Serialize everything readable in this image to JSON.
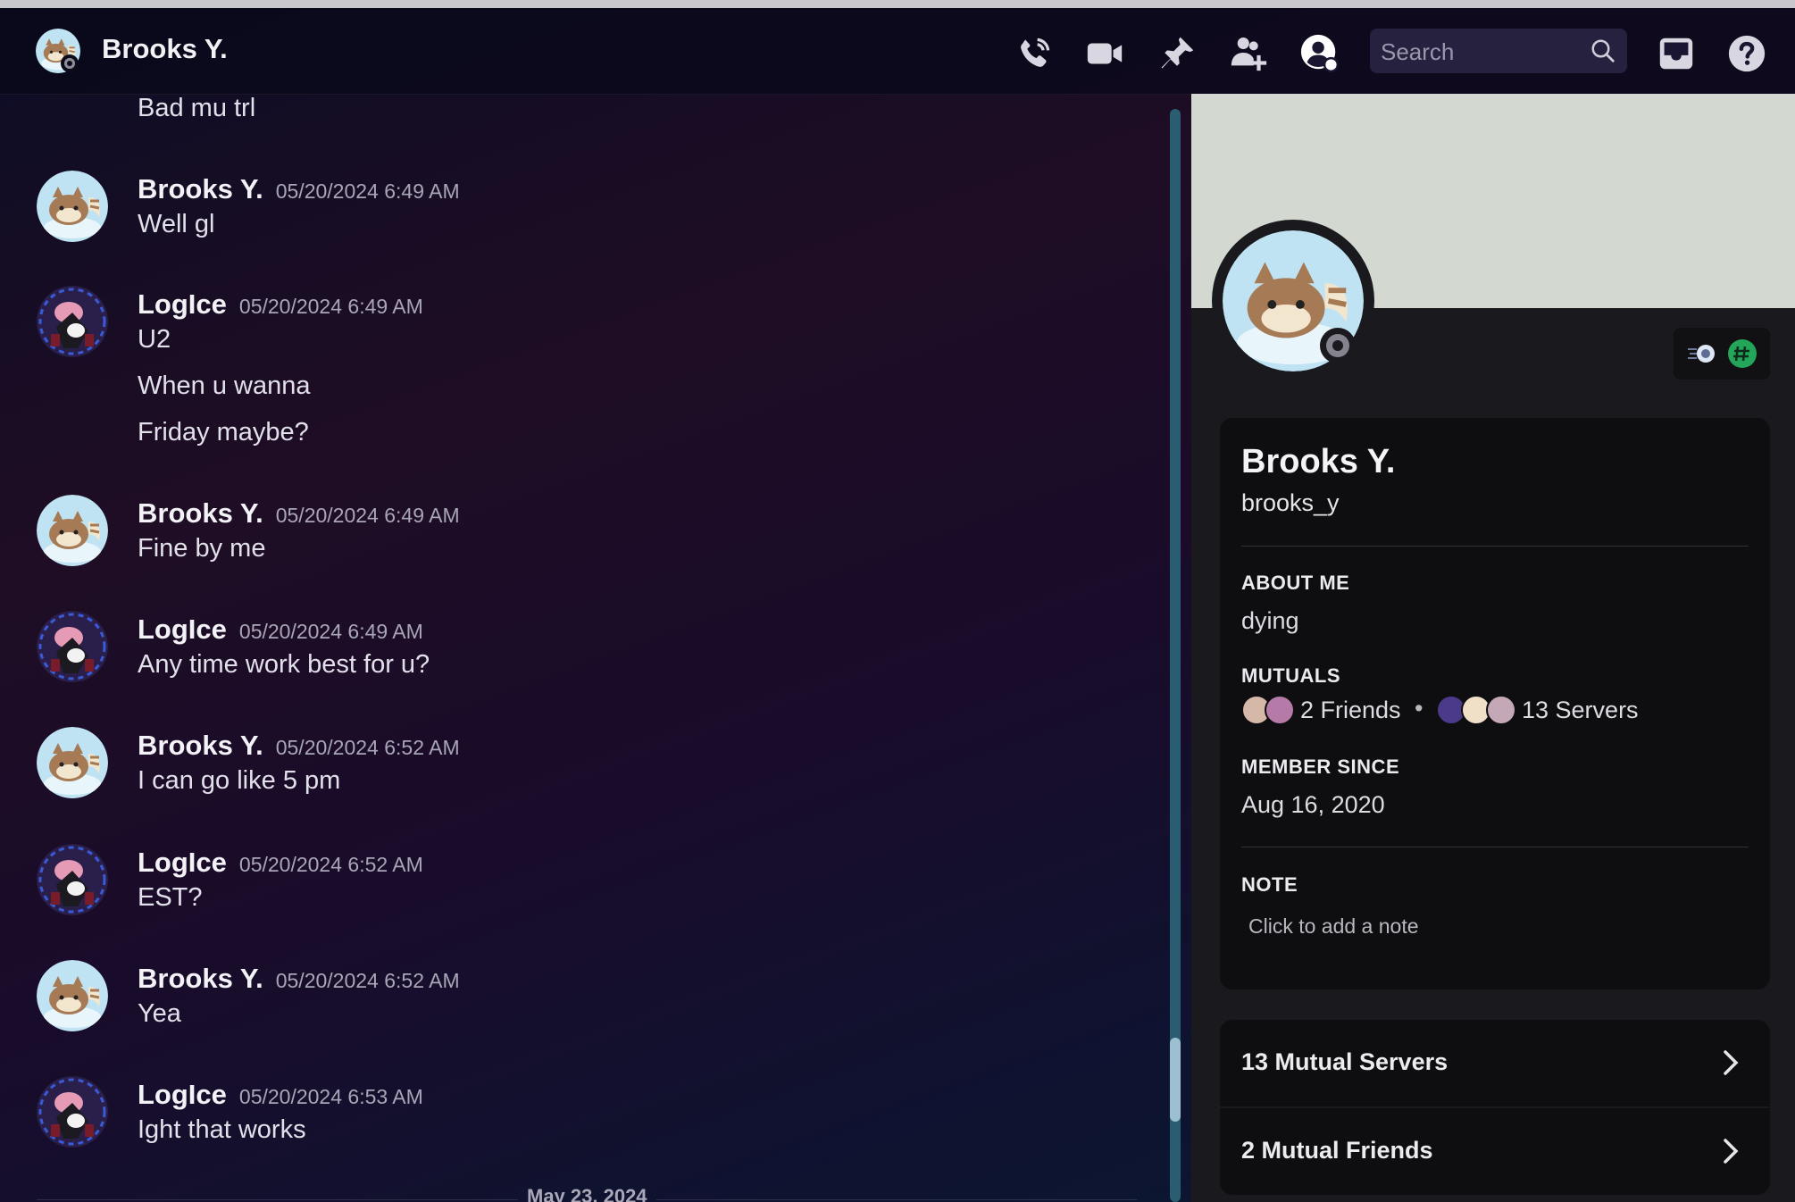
{
  "header": {
    "name": "Brooks Y.",
    "search_placeholder": "Search"
  },
  "messages": [
    {
      "continued": true,
      "lines": [
        "Bad mu trl"
      ]
    },
    {
      "author": "Brooks Y.",
      "timestamp": "05/20/2024 6:49 AM",
      "avatar": "furret",
      "lines": [
        "Well gl"
      ]
    },
    {
      "author": "LogIce",
      "timestamp": "05/20/2024 6:49 AM",
      "avatar": "anime",
      "lines": [
        "U2",
        "When u wanna",
        "Friday maybe?"
      ]
    },
    {
      "author": "Brooks Y.",
      "timestamp": "05/20/2024 6:49 AM",
      "avatar": "furret",
      "lines": [
        "Fine by me"
      ]
    },
    {
      "author": "LogIce",
      "timestamp": "05/20/2024 6:49 AM",
      "avatar": "anime",
      "lines": [
        "Any time work best for u?"
      ]
    },
    {
      "author": "Brooks Y.",
      "timestamp": "05/20/2024 6:52 AM",
      "avatar": "furret",
      "lines": [
        "I can go like 5 pm"
      ]
    },
    {
      "author": "LogIce",
      "timestamp": "05/20/2024 6:52 AM",
      "avatar": "anime",
      "lines": [
        "EST?"
      ]
    },
    {
      "author": "Brooks Y.",
      "timestamp": "05/20/2024 6:52 AM",
      "avatar": "furret",
      "lines": [
        "Yea"
      ]
    },
    {
      "author": "LogIce",
      "timestamp": "05/20/2024 6:53 AM",
      "avatar": "anime",
      "lines": [
        "Ight that works"
      ]
    }
  ],
  "date_divider": "May 23, 2024",
  "profile": {
    "display_name": "Brooks Y.",
    "username": "brooks_y",
    "about_heading": "ABOUT ME",
    "about": "dying",
    "mutuals_heading": "MUTUALS",
    "mutual_friends": "2 Friends",
    "mutual_servers": "13 Servers",
    "member_since_heading": "MEMBER SINCE",
    "member_since": "Aug 16, 2020",
    "note_heading": "NOTE",
    "note_placeholder": "Click to add a note",
    "rows": [
      "13 Mutual Servers",
      "2 Mutual Friends"
    ]
  },
  "colors": {
    "accent_scroll": "#2a5c72",
    "banner": "#d3d8d0",
    "nitro_badge": "#23a55a"
  }
}
